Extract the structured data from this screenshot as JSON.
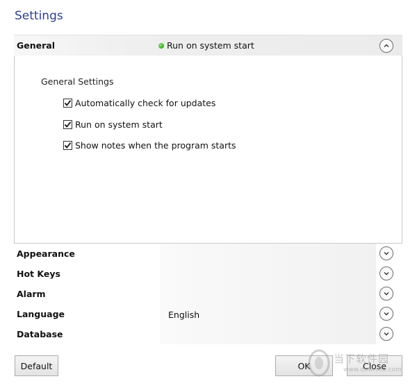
{
  "window": {
    "title": "Settings"
  },
  "sections": {
    "general": {
      "label": "General",
      "status_text": "Run on system start",
      "status_color": "#3fb52a",
      "chevron_icon": "chevron-up-icon",
      "group_title": "General Settings",
      "options": [
        {
          "label": "Automatically check for updates",
          "checked": true
        },
        {
          "label": "Run on system start",
          "checked": true
        },
        {
          "label": "Show notes when the program starts",
          "checked": true
        }
      ]
    },
    "appearance": {
      "label": "Appearance",
      "chevron_icon": "chevron-down-icon"
    },
    "hotkeys": {
      "label": "Hot Keys",
      "chevron_icon": "chevron-down-icon"
    },
    "alarm": {
      "label": "Alarm",
      "chevron_icon": "chevron-down-icon"
    },
    "language": {
      "label": "Language",
      "value": "English",
      "chevron_icon": "chevron-down-icon"
    },
    "database": {
      "label": "Database",
      "chevron_icon": "chevron-down-icon"
    }
  },
  "buttons": {
    "default_label": "Default",
    "ok_label": "OK",
    "close_label": "Close"
  },
  "watermark": {
    "text": "当下软件园",
    "url": "www.downxia.com"
  },
  "colors": {
    "title": "#2b3f8f",
    "section_header_bg": "#ebebeb"
  }
}
